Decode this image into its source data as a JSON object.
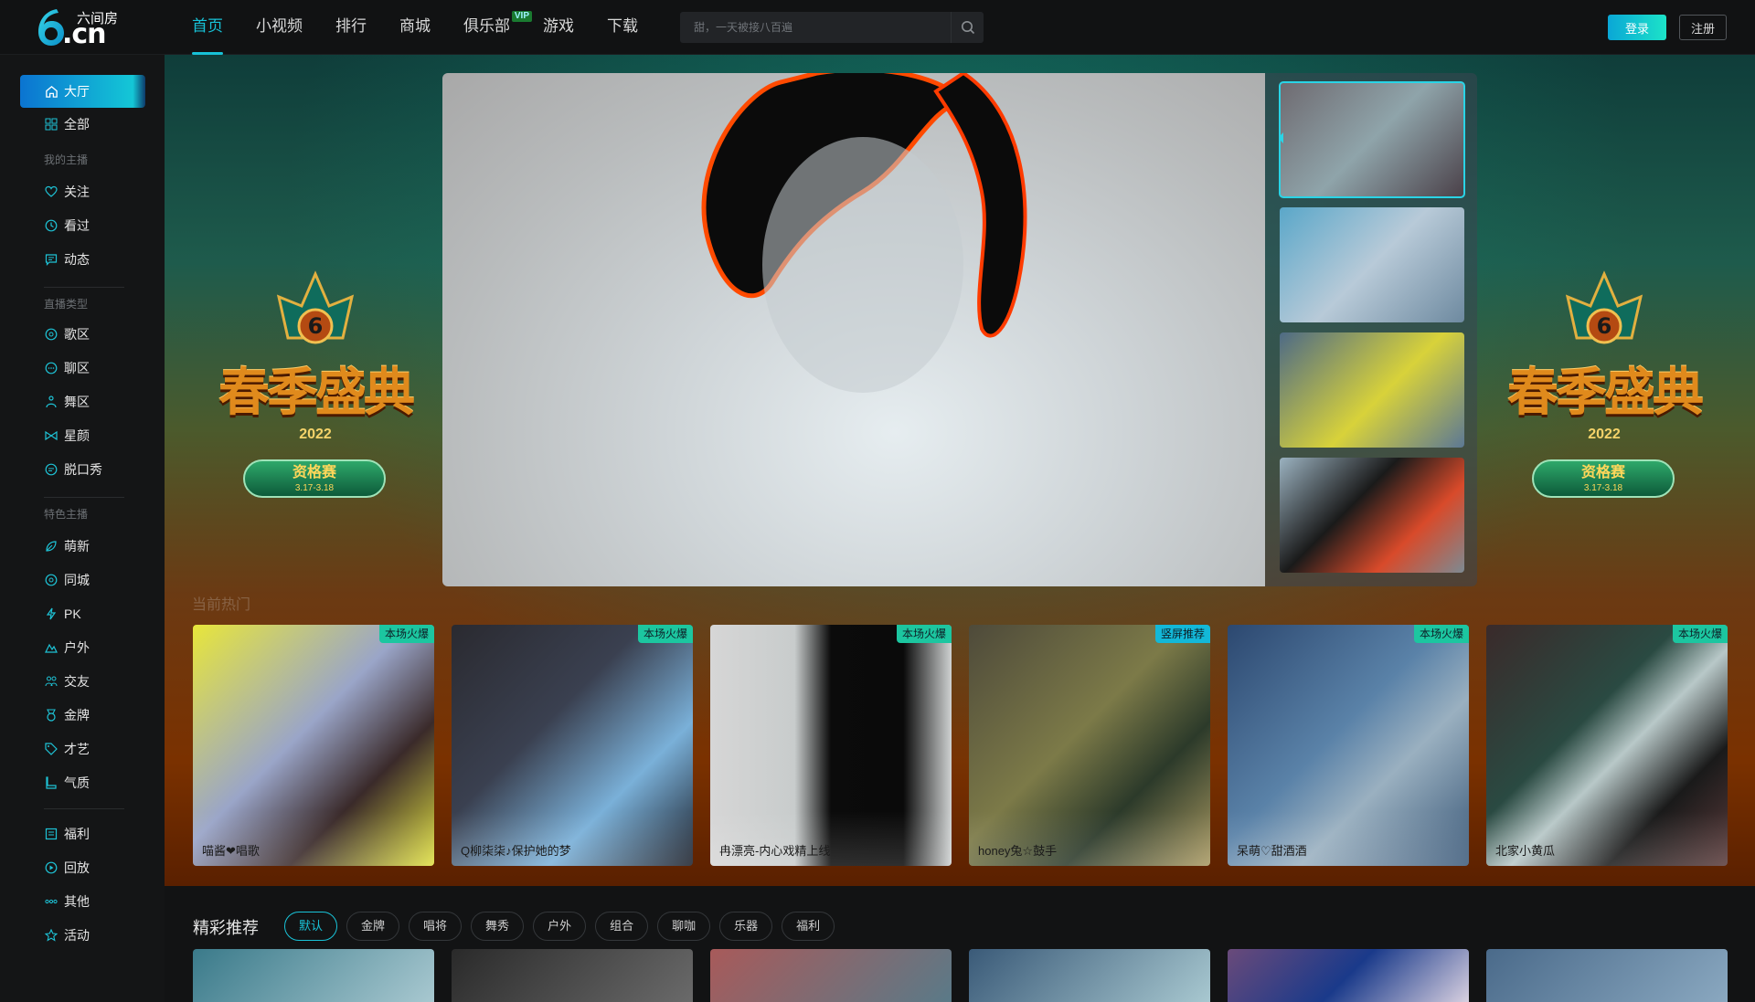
{
  "brand": {
    "cn": "六间房",
    "domain": ".cn"
  },
  "nav": [
    {
      "label": "首页",
      "active": true
    },
    {
      "label": "小视频"
    },
    {
      "label": "排行"
    },
    {
      "label": "商城"
    },
    {
      "label": "俱乐部",
      "badge": "VIP"
    },
    {
      "label": "游戏"
    },
    {
      "label": "下载"
    }
  ],
  "search": {
    "placeholder": "甜，一天被接八百遍"
  },
  "auth": {
    "login": "登录",
    "register": "注册"
  },
  "sidebar": {
    "hall": "大厅",
    "all": "全部",
    "group_my": "我的主播",
    "my": [
      "关注",
      "看过",
      "动态"
    ],
    "group_type": "直播类型",
    "types": [
      "歌区",
      "聊区",
      "舞区",
      "星颜",
      "脱口秀"
    ],
    "group_feature": "特色主播",
    "features": [
      "萌新",
      "同城",
      "PK",
      "户外",
      "交友",
      "金牌",
      "才艺",
      "气质"
    ],
    "extra": [
      "福利",
      "回放",
      "其他",
      "活动"
    ]
  },
  "banner": {
    "title": "春季盛典",
    "year": "2022",
    "stage": "资格赛",
    "dates": "3.17-3.18"
  },
  "hot": {
    "title": "当前热门",
    "cards": [
      {
        "name": "喵酱❤唱歌",
        "tag": "本场火爆"
      },
      {
        "name": "Q柳柒柒♪保护她的梦",
        "tag": "本场火爆"
      },
      {
        "name": "冉漂亮-内心戏精上线",
        "tag": "本场火爆"
      },
      {
        "name": "honey兔☆鼓手",
        "tag": "竖屏推荐"
      },
      {
        "name": "呆萌♡甜酒酒",
        "tag": "本场火爆"
      },
      {
        "name": "北家小黄瓜",
        "tag": "本场火爆"
      }
    ]
  },
  "recommend": {
    "title": "精彩推荐",
    "chips": [
      "默认",
      "金牌",
      "唱将",
      "舞秀",
      "户外",
      "组合",
      "聊咖",
      "乐器",
      "福利"
    ]
  },
  "colors": {
    "accent": "#17c2d7",
    "login_gradient": [
      "#0aa7d6",
      "#1ce3c8"
    ],
    "tag_hot": "#1cc6a0",
    "tag_vertical": "#13b8d8"
  }
}
